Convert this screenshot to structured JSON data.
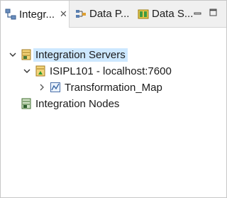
{
  "tabs": [
    {
      "label": "Integr...",
      "icon": "integration-view-icon",
      "active": true,
      "closable": true
    },
    {
      "label": "Data P...",
      "icon": "data-project-icon",
      "active": false
    },
    {
      "label": "Data S...",
      "icon": "data-source-icon",
      "active": false
    }
  ],
  "view_controls": {
    "minimize": "minimize-icon",
    "maximize": "maximize-icon"
  },
  "tree": {
    "root": {
      "label": "Integration Servers",
      "icon": "integration-servers-icon",
      "expanded": true,
      "selected": true
    },
    "server": {
      "label": "ISIPL101 - localhost:7600",
      "icon": "integration-server-icon",
      "expanded": true
    },
    "application": {
      "label": "Transformation_Map",
      "icon": "message-flow-icon",
      "expanded": false
    },
    "nodes": {
      "label": "Integration Nodes",
      "icon": "integration-nodes-icon"
    }
  },
  "colors": {
    "selection": "#cde8ff",
    "tabbar": "#f0f0f0",
    "border": "#c7c7c7"
  }
}
